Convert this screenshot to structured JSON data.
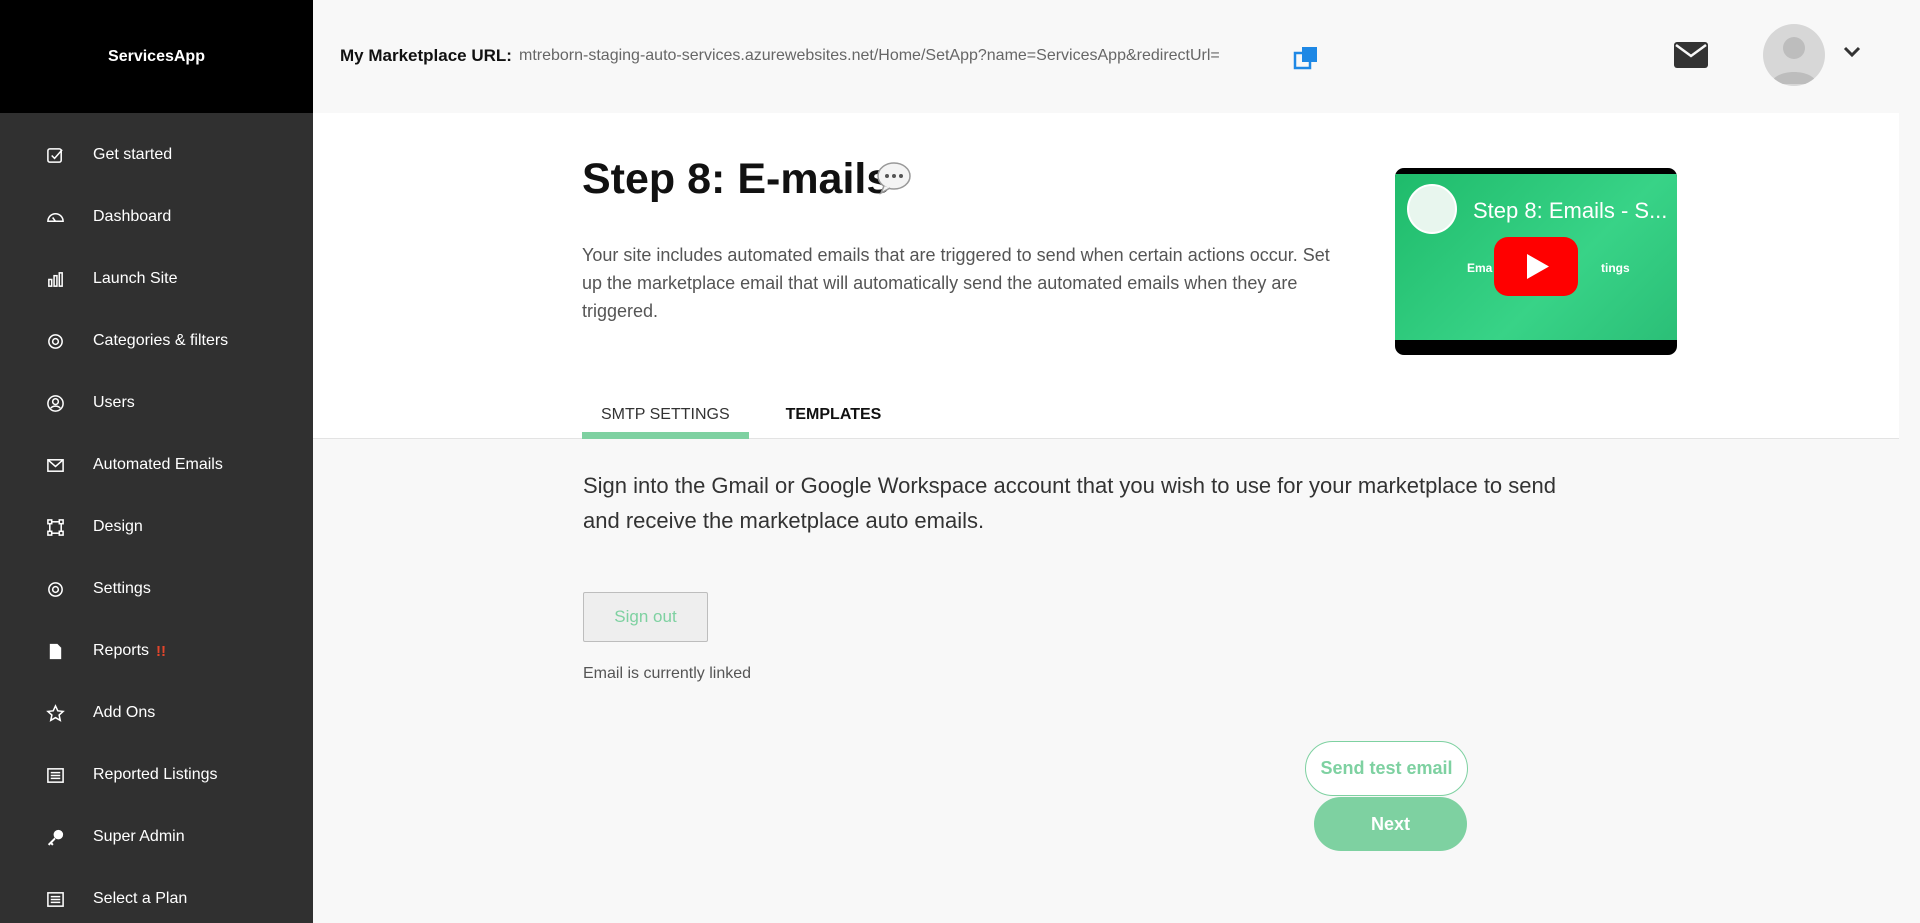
{
  "app": {
    "name": "ServicesApp"
  },
  "header": {
    "url_label": "My Marketplace URL:",
    "url_value": "mtreborn-staging-auto-services.azurewebsites.net/Home/SetApp?name=ServicesApp&redirectUrl="
  },
  "sidebar": {
    "items": [
      {
        "label": "Get started",
        "icon": "checkbox-icon"
      },
      {
        "label": "Dashboard",
        "icon": "speedometer-icon"
      },
      {
        "label": "Launch Site",
        "icon": "bar-chart-icon"
      },
      {
        "label": "Categories & filters",
        "icon": "gear-icon"
      },
      {
        "label": "Users",
        "icon": "user-circle-icon"
      },
      {
        "label": "Automated Emails",
        "icon": "envelope-icon"
      },
      {
        "label": "Design",
        "icon": "vector-square-icon"
      },
      {
        "label": "Settings",
        "icon": "gear-icon"
      },
      {
        "label": "Reports",
        "icon": "document-icon",
        "badge": "!!"
      },
      {
        "label": "Add Ons",
        "icon": "star-icon"
      },
      {
        "label": "Reported Listings",
        "icon": "list-icon"
      },
      {
        "label": "Super Admin",
        "icon": "key-icon"
      },
      {
        "label": "Select a Plan",
        "icon": "list-icon"
      }
    ]
  },
  "page": {
    "step_label": "Step 8:",
    "step_name": "E-mails",
    "intro": "Your site includes automated emails that are triggered to send when certain actions occur. Set up the marketplace email that will automatically send the automated emails when they are triggered.",
    "video": {
      "title": "Step 8: Emails - S...",
      "overlay_left": "Ema",
      "overlay_right": "tings"
    },
    "tabs": [
      {
        "label": "SMTP SETTINGS",
        "active": true
      },
      {
        "label": "TEMPLATES",
        "active": false
      }
    ],
    "instruction": "Sign into the Gmail or Google Workspace account that you wish to use for your marketplace to send and receive the marketplace auto emails.",
    "signout_label": "Sign out",
    "linked_status": "Email is currently linked",
    "send_test_label": "Send test email",
    "next_label": "Next"
  },
  "colors": {
    "accent": "#7ed1a1",
    "sidebar_bg": "#303030",
    "brand_bg": "#000000",
    "alert": "#e2452b",
    "link_blue": "#1e88e5"
  }
}
